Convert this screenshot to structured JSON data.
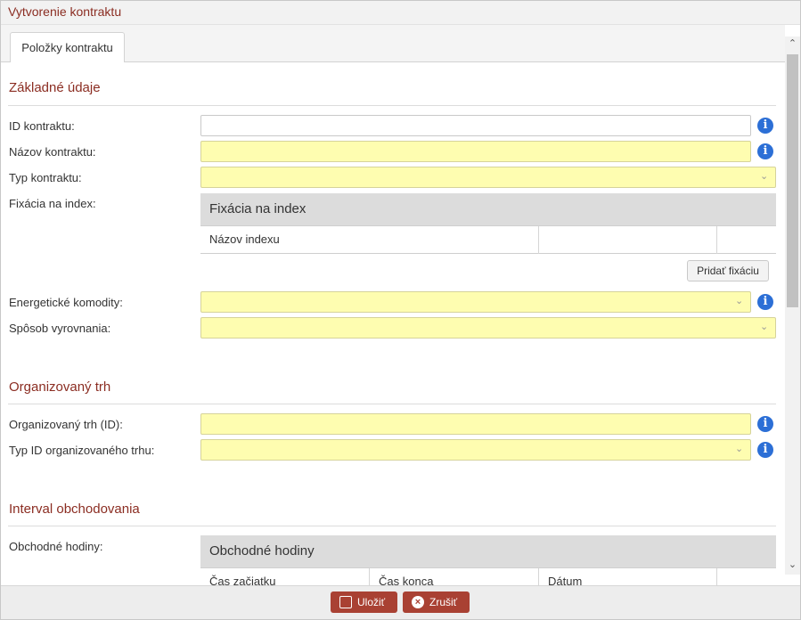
{
  "window": {
    "title": "Vytvorenie kontraktu"
  },
  "tabs": [
    {
      "label": "Položky kontraktu"
    }
  ],
  "sections": {
    "basic": {
      "title": "Základné údaje",
      "fields": {
        "contract_id": {
          "label": "ID kontraktu:",
          "value": ""
        },
        "contract_name": {
          "label": "Názov kontraktu:",
          "value": ""
        },
        "contract_type": {
          "label": "Typ kontraktu:",
          "value": ""
        },
        "index_fixation": {
          "label": "Fixácia na index:"
        },
        "energy_commodities": {
          "label": "Energetické komodity:",
          "value": ""
        },
        "settlement_method": {
          "label": "Spôsob vyrovnania:",
          "value": ""
        }
      },
      "fixation_grid": {
        "title": "Fixácia na index",
        "columns": [
          "Názov indexu",
          "",
          ""
        ],
        "add_button": "Pridať fixáciu"
      }
    },
    "market": {
      "title": "Organizovaný trh",
      "fields": {
        "market_id": {
          "label": "Organizovaný trh (ID):",
          "value": ""
        },
        "market_id_type": {
          "label": "Typ ID organizovaného trhu:",
          "value": ""
        }
      }
    },
    "trading": {
      "title": "Interval obchodovania",
      "fields": {
        "trading_hours": {
          "label": "Obchodné hodiny:"
        }
      },
      "hours_grid": {
        "title": "Obchodné hodiny",
        "columns": [
          "Čas začiatku",
          "Čas konca",
          "Dátum",
          ""
        ]
      }
    }
  },
  "footer": {
    "save_label": "Uložiť",
    "cancel_label": "Zrušiť"
  },
  "colors": {
    "accent": "#8b2d22",
    "button": "#a94133",
    "required_field": "#fefdb0",
    "info_icon": "#2c6fd6"
  }
}
